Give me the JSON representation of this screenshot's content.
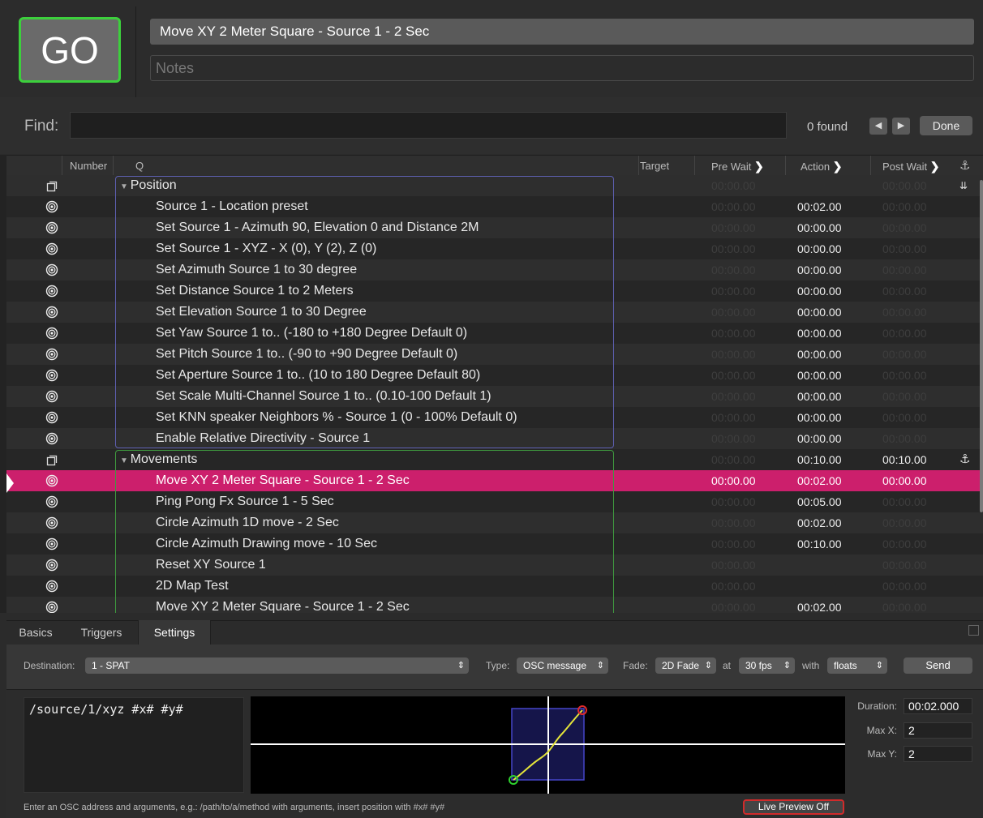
{
  "go_label": "GO",
  "cue_name": "Move XY 2 Meter Square - Source 1 - 2 Sec",
  "notes_placeholder": "Notes",
  "find": {
    "label": "Find:",
    "found": "0 found",
    "done": "Done"
  },
  "columns": {
    "number": "Number",
    "q": "Q",
    "target": "Target",
    "pre_wait": "Pre Wait",
    "action": "Action",
    "post_wait": "Post Wait"
  },
  "rows": [
    {
      "icon": "group",
      "name": "Position",
      "group": true,
      "pre": "00:00.00",
      "action": "",
      "post": "00:00.00",
      "act_on": false,
      "post_on": false,
      "pre_on": false,
      "mark": "double-down"
    },
    {
      "icon": "target",
      "name": "Source 1 - Location preset",
      "pre": "00:00.00",
      "action": "00:02.00",
      "post": "00:00.00",
      "pre_on": false,
      "act_on": true,
      "post_on": false
    },
    {
      "icon": "target",
      "name": "Set Source 1 - Azimuth 90, Elevation 0 and Distance 2M",
      "pre": "00:00.00",
      "action": "00:00.00",
      "post": "00:00.00",
      "pre_on": false,
      "act_on": true,
      "post_on": false
    },
    {
      "icon": "target",
      "name": "Set Source 1 - XYZ - X (0), Y (2), Z (0)",
      "pre": "00:00.00",
      "action": "00:00.00",
      "post": "00:00.00",
      "pre_on": false,
      "act_on": true,
      "post_on": false
    },
    {
      "icon": "target",
      "name": "Set Azimuth Source 1 to 30 degree",
      "pre": "00:00.00",
      "action": "00:00.00",
      "post": "00:00.00",
      "pre_on": false,
      "act_on": true,
      "post_on": false
    },
    {
      "icon": "target",
      "name": "Set Distance Source 1 to 2 Meters",
      "pre": "00:00.00",
      "action": "00:00.00",
      "post": "00:00.00",
      "pre_on": false,
      "act_on": true,
      "post_on": false
    },
    {
      "icon": "target",
      "name": "Set Elevation Source 1 to 30 Degree",
      "pre": "00:00.00",
      "action": "00:00.00",
      "post": "00:00.00",
      "pre_on": false,
      "act_on": true,
      "post_on": false
    },
    {
      "icon": "target",
      "name": "Set Yaw Source 1 to.. (-180 to +180 Degree Default 0)",
      "pre": "00:00.00",
      "action": "00:00.00",
      "post": "00:00.00",
      "pre_on": false,
      "act_on": true,
      "post_on": false
    },
    {
      "icon": "target",
      "name": "Set Pitch Source 1 to.. (-90 to +90 Degree Default 0)",
      "pre": "00:00.00",
      "action": "00:00.00",
      "post": "00:00.00",
      "pre_on": false,
      "act_on": true,
      "post_on": false
    },
    {
      "icon": "target",
      "name": "Set Aperture Source 1 to.. (10 to 180 Degree Default 80)",
      "pre": "00:00.00",
      "action": "00:00.00",
      "post": "00:00.00",
      "pre_on": false,
      "act_on": true,
      "post_on": false
    },
    {
      "icon": "target",
      "name": "Set Scale Multi-Channel Source 1 to.. (0.10-100 Default 1)",
      "pre": "00:00.00",
      "action": "00:00.00",
      "post": "00:00.00",
      "pre_on": false,
      "act_on": true,
      "post_on": false
    },
    {
      "icon": "target",
      "name": "Set KNN speaker Neighbors % -  Source 1 (0 - 100% Default 0)",
      "pre": "00:00.00",
      "action": "00:00.00",
      "post": "00:00.00",
      "pre_on": false,
      "act_on": true,
      "post_on": false
    },
    {
      "icon": "target",
      "name": "Enable Relative Directivity - Source 1",
      "pre": "00:00.00",
      "action": "00:00.00",
      "post": "00:00.00",
      "pre_on": false,
      "act_on": true,
      "post_on": false
    },
    {
      "icon": "group",
      "name": "Movements",
      "group": true,
      "pre": "00:00.00",
      "action": "00:10.00",
      "post": "00:10.00",
      "pre_on": false,
      "act_on": true,
      "post_on": true,
      "mark": "anchor"
    },
    {
      "icon": "target",
      "name": "Move XY 2 Meter Square - Source 1 - 2 Sec",
      "pre": "00:00.00",
      "action": "00:02.00",
      "post": "00:00.00",
      "pre_on": true,
      "act_on": true,
      "post_on": true,
      "selected": true
    },
    {
      "icon": "target",
      "name": "Ping Pong Fx Source 1 - 5 Sec",
      "pre": "00:00.00",
      "action": "00:05.00",
      "post": "00:00.00",
      "pre_on": false,
      "act_on": true,
      "post_on": false
    },
    {
      "icon": "target",
      "name": "Circle Azimuth 1D move - 2 Sec",
      "pre": "00:00.00",
      "action": "00:02.00",
      "post": "00:00.00",
      "pre_on": false,
      "act_on": true,
      "post_on": false
    },
    {
      "icon": "target",
      "name": "Circle Azimuth Drawing move - 10 Sec",
      "pre": "00:00.00",
      "action": "00:10.00",
      "post": "00:00.00",
      "pre_on": false,
      "act_on": true,
      "post_on": false
    },
    {
      "icon": "target",
      "name": "Reset XY Source 1",
      "pre": "00:00.00",
      "action": "",
      "post": "00:00.00",
      "pre_on": false,
      "act_on": false,
      "post_on": false
    },
    {
      "icon": "target",
      "name": "2D Map Test",
      "pre": "00:00.00",
      "action": "",
      "post": "00:00.00",
      "pre_on": false,
      "act_on": false,
      "post_on": false
    },
    {
      "icon": "target",
      "name": "Move XY 2 Meter Square - Source 1 - 2 Sec",
      "pre": "00:00.00",
      "action": "00:02.00",
      "post": "00:00.00",
      "pre_on": false,
      "act_on": true,
      "post_on": false
    }
  ],
  "tabs": {
    "basics": "Basics",
    "triggers": "Triggers",
    "settings": "Settings"
  },
  "settings": {
    "destination_label": "Destination:",
    "destination": "1 - SPAT",
    "type_label": "Type:",
    "type": "OSC message",
    "fade_label": "Fade:",
    "fade": "2D Fade",
    "at_label": "at",
    "fps": "30 fps",
    "with_label": "with",
    "with": "floats",
    "send": "Send",
    "osc_address": "/source/1/xyz #x# #y#",
    "duration_label": "Duration:",
    "duration": "00:02.000",
    "max_x_label": "Max X:",
    "max_x": "2",
    "max_y_label": "Max Y:",
    "max_y": "2",
    "hint": "Enter an OSC address and arguments, e.g.: /path/to/a/method with arguments, insert position with #x# #y#",
    "live_preview": "Live Preview Off"
  },
  "colors": {
    "go_border": "#3cd03c",
    "selection": "#cc1f6c",
    "position_group": "#5d5fb0",
    "movements_group": "#3f9a3f",
    "live_border": "#d12b2b"
  }
}
